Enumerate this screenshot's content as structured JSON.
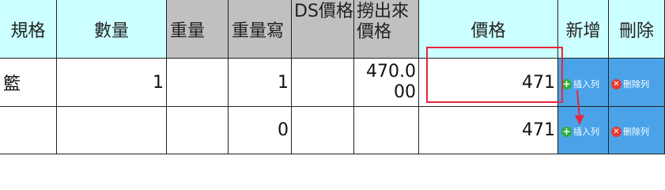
{
  "headers": {
    "spec": "規格",
    "quantity": "數量",
    "weight": "重量",
    "weight_write": "重量寫",
    "ds_price": "DS價格",
    "pull_price": "撈出來價格",
    "price": "價格",
    "add": "新增",
    "delete": "刪除"
  },
  "rows": [
    {
      "spec": "籃",
      "quantity": "1",
      "weight": "",
      "weight_write": "1",
      "ds_price": "",
      "pull_price": "470.000",
      "price": "471",
      "insert_label": "插入列",
      "delete_label": "刪除列"
    },
    {
      "spec": "",
      "quantity": "",
      "weight": "",
      "weight_write": "0",
      "ds_price": "",
      "pull_price": "",
      "price": "471",
      "insert_label": "插入列",
      "delete_label": "刪除列"
    }
  ],
  "icons": {
    "insert": "plus-circle-icon",
    "delete": "x-circle-icon"
  },
  "colors": {
    "header_cyan": "#ccffff",
    "header_gray": "#c0c0c0",
    "button_blue": "#4aa3e8",
    "highlight_red": "#e8263c"
  }
}
